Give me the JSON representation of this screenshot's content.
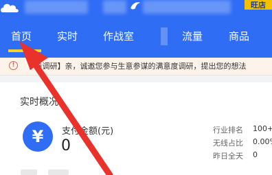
{
  "header": {
    "store_badge": "旺店"
  },
  "nav": {
    "tabs": [
      "首页",
      "实时",
      "作战室",
      "流量",
      "商品"
    ],
    "active_tab": "首页"
  },
  "notice": {
    "text": "【   卷调研】亲，诚邀您参与生意参谋的满意度调研，提出您的想法"
  },
  "overview": {
    "title": "实时概况",
    "pay_amount_label": "支付金额(元)",
    "pay_amount_value": "0",
    "stats": [
      {
        "label": "行业排名",
        "value": "100+"
      },
      {
        "label": "无线占比",
        "value": "0.00%"
      },
      {
        "label": "昨日全天",
        "value": "0"
      }
    ]
  },
  "colors": {
    "brand_blue": "#2f6df5",
    "active_underline": "#f5d22f",
    "annotation_arrow": "#e8322b"
  }
}
